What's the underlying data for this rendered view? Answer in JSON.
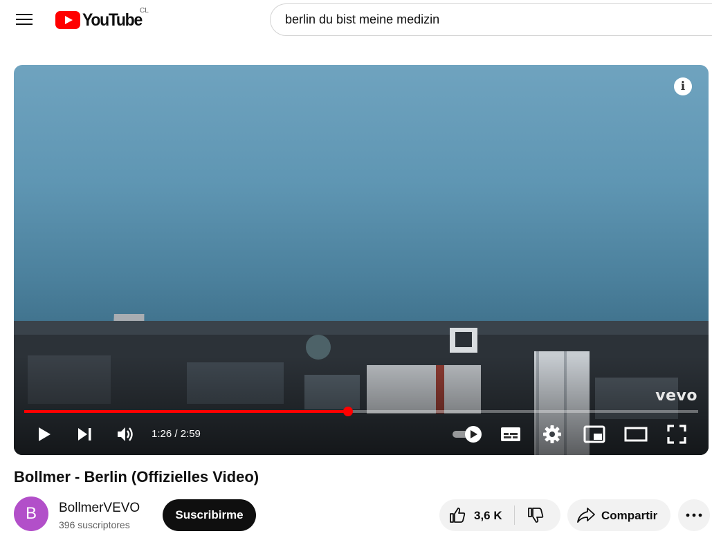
{
  "header": {
    "logo_text": "YouTube",
    "country_code": "CL",
    "search_value": "berlin du bist meine medizin"
  },
  "player": {
    "current_time": "1:26",
    "duration": "2:59",
    "time_display": "1:26 / 2:59",
    "progress": 0.48,
    "watermark": "vevo",
    "info_glyph": "i",
    "icons": [
      "play-icon",
      "next-icon",
      "volume-icon",
      "autoplay-toggle-icon",
      "subtitles-icon",
      "settings-icon",
      "miniplayer-icon",
      "theater-mode-icon",
      "fullscreen-icon"
    ]
  },
  "video": {
    "title": "Bollmer - Berlin (Offizielles Video)"
  },
  "channel": {
    "avatar_letter": "B",
    "name": "BollmerVEVO",
    "subscribers": "396 suscriptores",
    "subscribe_label": "Suscribirme"
  },
  "actions": {
    "like_count": "3,6 K",
    "share_label": "Compartir"
  },
  "colors": {
    "brand_red": "#ff0000",
    "avatar_purple": "#b24fc9"
  }
}
